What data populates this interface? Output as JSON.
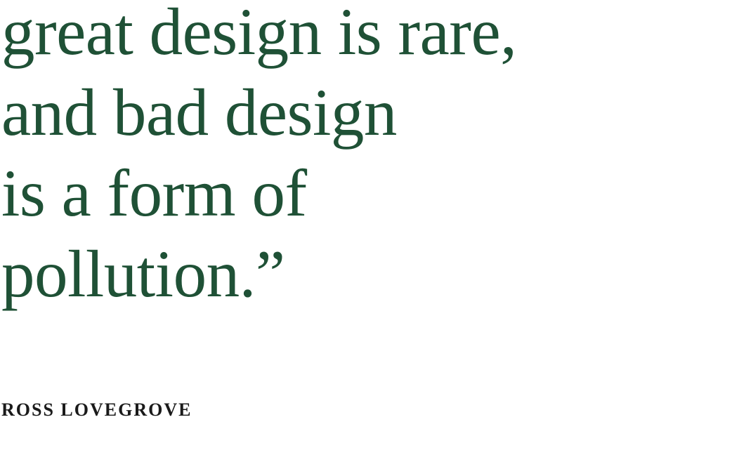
{
  "quote": {
    "lines": [
      "great design is rare,",
      "and bad design",
      "is a form of",
      "pollution.”"
    ]
  },
  "author": "ROSS LOVEGROVE",
  "colors": {
    "quote": "#1f5136",
    "author": "#1a1a1a"
  }
}
